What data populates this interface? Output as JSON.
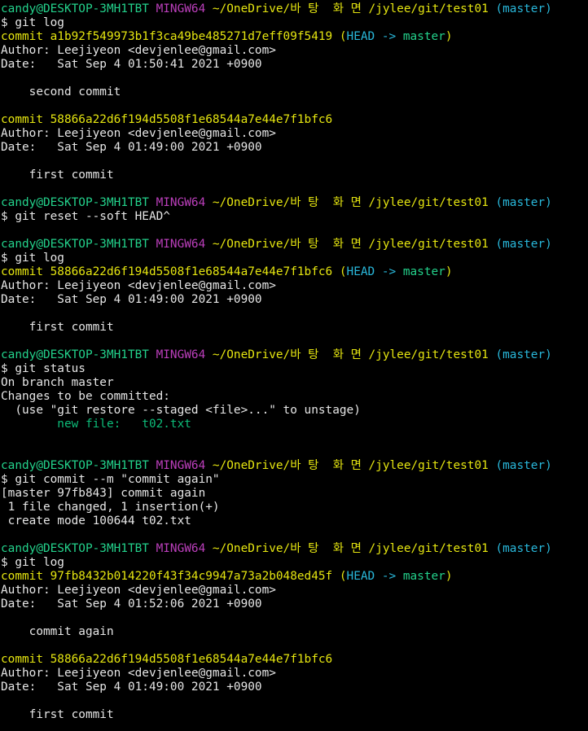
{
  "colors": {
    "default": "#e6e6e6",
    "prompt_user": "#23d18b",
    "prompt_host": "#bc3fbc",
    "prompt_path": "#e5e510",
    "prompt_branch": "#29b8db",
    "commit_hash": "#e5e510",
    "head_ref": "#29b8db",
    "branch_ref": "#23d18b",
    "staged_file": "#0dbc79"
  },
  "terminal": {
    "lines": [
      {
        "segs": [
          {
            "t": "candy@DESKTOP-3MH1TBT ",
            "c": "prompt_user"
          },
          {
            "t": "MINGW64 ",
            "c": "prompt_host"
          },
          {
            "t": "~/OneDrive/바 탕  화 면 /jylee/git/test01 ",
            "c": "prompt_path"
          },
          {
            "t": "(master)",
            "c": "prompt_branch"
          }
        ]
      },
      {
        "segs": [
          {
            "t": "$ git log",
            "c": "default"
          }
        ]
      },
      {
        "segs": [
          {
            "t": "commit a1b92f549973b1f3ca49be485271d7eff09f5419 ",
            "c": "commit_hash"
          },
          {
            "t": "(",
            "c": "commit_hash"
          },
          {
            "t": "HEAD -> ",
            "c": "head_ref"
          },
          {
            "t": "master",
            "c": "branch_ref"
          },
          {
            "t": ")",
            "c": "commit_hash"
          }
        ]
      },
      {
        "segs": [
          {
            "t": "Author: Leejiyeon <devjenlee@gmail.com>",
            "c": "default"
          }
        ]
      },
      {
        "segs": [
          {
            "t": "Date:   Sat Sep 4 01:50:41 2021 +0900",
            "c": "default"
          }
        ]
      },
      {
        "segs": [
          {
            "t": "",
            "c": "default"
          }
        ]
      },
      {
        "segs": [
          {
            "t": "    second commit",
            "c": "default"
          }
        ]
      },
      {
        "segs": [
          {
            "t": "",
            "c": "default"
          }
        ]
      },
      {
        "segs": [
          {
            "t": "commit 58866a22d6f194d5508f1e68544a7e44e7f1bfc6",
            "c": "commit_hash"
          }
        ]
      },
      {
        "segs": [
          {
            "t": "Author: Leejiyeon <devjenlee@gmail.com>",
            "c": "default"
          }
        ]
      },
      {
        "segs": [
          {
            "t": "Date:   Sat Sep 4 01:49:00 2021 +0900",
            "c": "default"
          }
        ]
      },
      {
        "segs": [
          {
            "t": "",
            "c": "default"
          }
        ]
      },
      {
        "segs": [
          {
            "t": "    first commit",
            "c": "default"
          }
        ]
      },
      {
        "segs": [
          {
            "t": "",
            "c": "default"
          }
        ]
      },
      {
        "segs": [
          {
            "t": "candy@DESKTOP-3MH1TBT ",
            "c": "prompt_user"
          },
          {
            "t": "MINGW64 ",
            "c": "prompt_host"
          },
          {
            "t": "~/OneDrive/바 탕  화 면 /jylee/git/test01 ",
            "c": "prompt_path"
          },
          {
            "t": "(master)",
            "c": "prompt_branch"
          }
        ]
      },
      {
        "segs": [
          {
            "t": "$ git reset --soft HEAD^",
            "c": "default"
          }
        ]
      },
      {
        "segs": [
          {
            "t": "",
            "c": "default"
          }
        ]
      },
      {
        "segs": [
          {
            "t": "candy@DESKTOP-3MH1TBT ",
            "c": "prompt_user"
          },
          {
            "t": "MINGW64 ",
            "c": "prompt_host"
          },
          {
            "t": "~/OneDrive/바 탕  화 면 /jylee/git/test01 ",
            "c": "prompt_path"
          },
          {
            "t": "(master)",
            "c": "prompt_branch"
          }
        ]
      },
      {
        "segs": [
          {
            "t": "$ git log",
            "c": "default"
          }
        ]
      },
      {
        "segs": [
          {
            "t": "commit 58866a22d6f194d5508f1e68544a7e44e7f1bfc6 ",
            "c": "commit_hash"
          },
          {
            "t": "(",
            "c": "commit_hash"
          },
          {
            "t": "HEAD -> ",
            "c": "head_ref"
          },
          {
            "t": "master",
            "c": "branch_ref"
          },
          {
            "t": ")",
            "c": "commit_hash"
          }
        ]
      },
      {
        "segs": [
          {
            "t": "Author: Leejiyeon <devjenlee@gmail.com>",
            "c": "default"
          }
        ]
      },
      {
        "segs": [
          {
            "t": "Date:   Sat Sep 4 01:49:00 2021 +0900",
            "c": "default"
          }
        ]
      },
      {
        "segs": [
          {
            "t": "",
            "c": "default"
          }
        ]
      },
      {
        "segs": [
          {
            "t": "    first commit",
            "c": "default"
          }
        ]
      },
      {
        "segs": [
          {
            "t": "",
            "c": "default"
          }
        ]
      },
      {
        "segs": [
          {
            "t": "candy@DESKTOP-3MH1TBT ",
            "c": "prompt_user"
          },
          {
            "t": "MINGW64 ",
            "c": "prompt_host"
          },
          {
            "t": "~/OneDrive/바 탕  화 면 /jylee/git/test01 ",
            "c": "prompt_path"
          },
          {
            "t": "(master)",
            "c": "prompt_branch"
          }
        ]
      },
      {
        "segs": [
          {
            "t": "$ git status",
            "c": "default"
          }
        ]
      },
      {
        "segs": [
          {
            "t": "On branch master",
            "c": "default"
          }
        ]
      },
      {
        "segs": [
          {
            "t": "Changes to be committed:",
            "c": "default"
          }
        ]
      },
      {
        "segs": [
          {
            "t": "  (use \"git restore --staged <file>...\" to unstage)",
            "c": "default"
          }
        ]
      },
      {
        "segs": [
          {
            "t": "        new file:   t02.txt",
            "c": "staged_file"
          }
        ]
      },
      {
        "segs": [
          {
            "t": "",
            "c": "default"
          }
        ]
      },
      {
        "segs": [
          {
            "t": "",
            "c": "default"
          }
        ]
      },
      {
        "segs": [
          {
            "t": "candy@DESKTOP-3MH1TBT ",
            "c": "prompt_user"
          },
          {
            "t": "MINGW64 ",
            "c": "prompt_host"
          },
          {
            "t": "~/OneDrive/바 탕  화 면 /jylee/git/test01 ",
            "c": "prompt_path"
          },
          {
            "t": "(master)",
            "c": "prompt_branch"
          }
        ]
      },
      {
        "segs": [
          {
            "t": "$ git commit --m \"commit again\"",
            "c": "default"
          }
        ]
      },
      {
        "segs": [
          {
            "t": "[master 97fb843] commit again",
            "c": "default"
          }
        ]
      },
      {
        "segs": [
          {
            "t": " 1 file changed, 1 insertion(+)",
            "c": "default"
          }
        ]
      },
      {
        "segs": [
          {
            "t": " create mode 100644 t02.txt",
            "c": "default"
          }
        ]
      },
      {
        "segs": [
          {
            "t": "",
            "c": "default"
          }
        ]
      },
      {
        "segs": [
          {
            "t": "candy@DESKTOP-3MH1TBT ",
            "c": "prompt_user"
          },
          {
            "t": "MINGW64 ",
            "c": "prompt_host"
          },
          {
            "t": "~/OneDrive/바 탕  화 면 /jylee/git/test01 ",
            "c": "prompt_path"
          },
          {
            "t": "(master)",
            "c": "prompt_branch"
          }
        ]
      },
      {
        "segs": [
          {
            "t": "$ git log",
            "c": "default"
          }
        ]
      },
      {
        "segs": [
          {
            "t": "commit 97fb8432b014220f43f34c9947a73a2b048ed45f ",
            "c": "commit_hash"
          },
          {
            "t": "(",
            "c": "commit_hash"
          },
          {
            "t": "HEAD -> ",
            "c": "head_ref"
          },
          {
            "t": "master",
            "c": "branch_ref"
          },
          {
            "t": ")",
            "c": "commit_hash"
          }
        ]
      },
      {
        "segs": [
          {
            "t": "Author: Leejiyeon <devjenlee@gmail.com>",
            "c": "default"
          }
        ]
      },
      {
        "segs": [
          {
            "t": "Date:   Sat Sep 4 01:52:06 2021 +0900",
            "c": "default"
          }
        ]
      },
      {
        "segs": [
          {
            "t": "",
            "c": "default"
          }
        ]
      },
      {
        "segs": [
          {
            "t": "    commit again",
            "c": "default"
          }
        ]
      },
      {
        "segs": [
          {
            "t": "",
            "c": "default"
          }
        ]
      },
      {
        "segs": [
          {
            "t": "commit 58866a22d6f194d5508f1e68544a7e44e7f1bfc6",
            "c": "commit_hash"
          }
        ]
      },
      {
        "segs": [
          {
            "t": "Author: Leejiyeon <devjenlee@gmail.com>",
            "c": "default"
          }
        ]
      },
      {
        "segs": [
          {
            "t": "Date:   Sat Sep 4 01:49:00 2021 +0900",
            "c": "default"
          }
        ]
      },
      {
        "segs": [
          {
            "t": "",
            "c": "default"
          }
        ]
      },
      {
        "segs": [
          {
            "t": "    first commit",
            "c": "default"
          }
        ]
      }
    ]
  }
}
